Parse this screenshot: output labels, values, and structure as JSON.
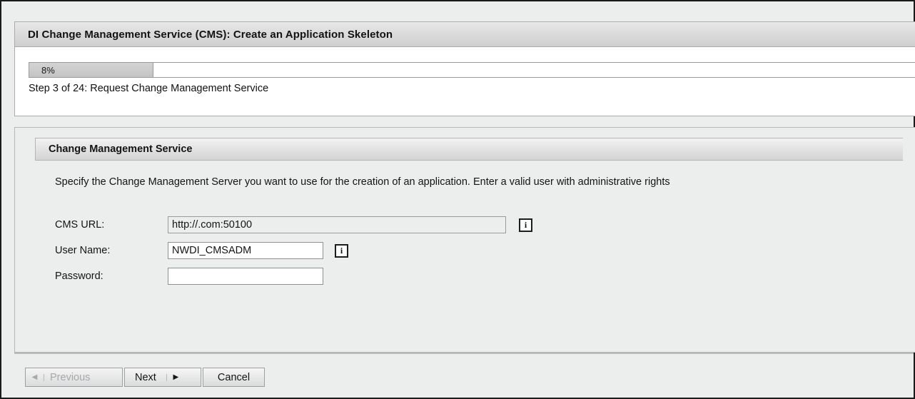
{
  "window": {
    "title": "DI Change Management Service (CMS): Create an Application Skeleton"
  },
  "progress": {
    "percent_label": "8%",
    "percent_value": 8,
    "fill_ratio_pixels": 0.14,
    "step_text": "Step 3 of 24: Request Change Management Service",
    "step_current": 3,
    "step_total": 24
  },
  "section": {
    "header": "Change Management Service",
    "description": "Specify the Change Management Server you want to use for the creation of an application. Enter a valid user with administrative rights"
  },
  "form": {
    "fields": [
      {
        "label": "CMS URL:",
        "value": "http://.com:50100",
        "placeholder": "",
        "type": "text",
        "readonly": true,
        "has_info_icon": true,
        "info_icon": "info-icon",
        "name": "cms-url"
      },
      {
        "label": "User Name:",
        "value": "NWDI_CMSADM",
        "placeholder": "",
        "type": "text",
        "readonly": false,
        "has_info_icon": true,
        "info_icon": "info-icon",
        "name": "user-name"
      },
      {
        "label": "Password:",
        "value": "",
        "placeholder": "",
        "type": "password",
        "readonly": false,
        "has_info_icon": false,
        "info_icon": "",
        "name": "password"
      }
    ],
    "info_icon_glyph": "i"
  },
  "footer": {
    "buttons": [
      {
        "label": "Previous",
        "name": "previous-button",
        "disabled": true,
        "arrow": "◀",
        "arrow_side": "left",
        "arrow_icon": "chevron-left-icon"
      },
      {
        "label": "Next",
        "name": "next-button",
        "disabled": false,
        "arrow": "▶",
        "arrow_side": "right",
        "arrow_icon": "chevron-right-icon"
      },
      {
        "label": "Cancel",
        "name": "cancel-button",
        "disabled": false,
        "arrow": "",
        "arrow_side": "none",
        "arrow_icon": ""
      }
    ]
  },
  "colors": {
    "page_background": "#eceded",
    "panel_white": "#ffffff",
    "border": "#a9abad",
    "text": "#141414",
    "disabled_text": "#a6a8aa",
    "progress_fill": "#cacaca"
  }
}
